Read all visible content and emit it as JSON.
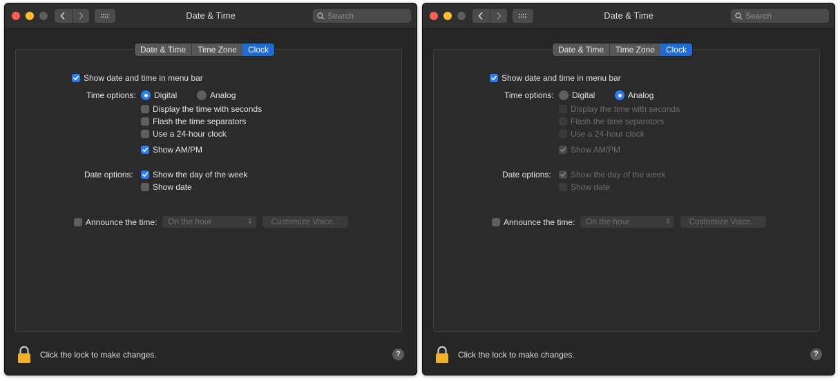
{
  "windows": [
    {
      "title": "Date & Time",
      "search": {
        "placeholder": "Search"
      },
      "tabs": [
        {
          "label": "Date & Time",
          "active": false
        },
        {
          "label": "Time Zone",
          "active": false
        },
        {
          "label": "Clock",
          "active": true
        }
      ],
      "show_menu_bar": {
        "label": "Show date and time in menu bar",
        "checked": true
      },
      "time_options": {
        "label": "Time options:",
        "digital": {
          "label": "Digital",
          "selected": true
        },
        "analog": {
          "label": "Analog",
          "selected": false
        },
        "seconds": {
          "label": "Display the time with seconds",
          "checked": false,
          "enabled": true
        },
        "flash": {
          "label": "Flash the time separators",
          "checked": false,
          "enabled": true
        },
        "clock24": {
          "label": "Use a 24-hour clock",
          "checked": false,
          "enabled": true
        },
        "ampm": {
          "label": "Show AM/PM",
          "checked": true,
          "enabled": true
        }
      },
      "date_options": {
        "label": "Date options:",
        "day_of_week": {
          "label": "Show the day of the week",
          "checked": true,
          "enabled": true
        },
        "show_date": {
          "label": "Show date",
          "checked": false,
          "enabled": true
        }
      },
      "announce": {
        "label": "Announce the time:",
        "checked": false,
        "interval": "On the hour",
        "customize_label": "Customize Voice..."
      },
      "lock_message": "Click the lock to make changes.",
      "help_label": "?"
    },
    {
      "title": "Date & Time",
      "search": {
        "placeholder": "Search"
      },
      "tabs": [
        {
          "label": "Date & Time",
          "active": false
        },
        {
          "label": "Time Zone",
          "active": false
        },
        {
          "label": "Clock",
          "active": true
        }
      ],
      "show_menu_bar": {
        "label": "Show date and time in menu bar",
        "checked": true
      },
      "time_options": {
        "label": "Time options:",
        "digital": {
          "label": "Digital",
          "selected": false
        },
        "analog": {
          "label": "Analog",
          "selected": true
        },
        "seconds": {
          "label": "Display the time with seconds",
          "checked": false,
          "enabled": false
        },
        "flash": {
          "label": "Flash the time separators",
          "checked": false,
          "enabled": false
        },
        "clock24": {
          "label": "Use a 24-hour clock",
          "checked": false,
          "enabled": false
        },
        "ampm": {
          "label": "Show AM/PM",
          "checked": true,
          "enabled": false
        }
      },
      "date_options": {
        "label": "Date options:",
        "day_of_week": {
          "label": "Show the day of the week",
          "checked": true,
          "enabled": false
        },
        "show_date": {
          "label": "Show date",
          "checked": false,
          "enabled": false
        }
      },
      "announce": {
        "label": "Announce the time:",
        "checked": false,
        "interval": "On the hour",
        "customize_label": "Customize Voice..."
      },
      "lock_message": "Click the lock to make changes.",
      "help_label": "?"
    }
  ],
  "colors": {
    "accent": "#2a7cf6",
    "close": "#fe5f57",
    "minimize": "#febc2e",
    "window_bg": "#262626"
  }
}
